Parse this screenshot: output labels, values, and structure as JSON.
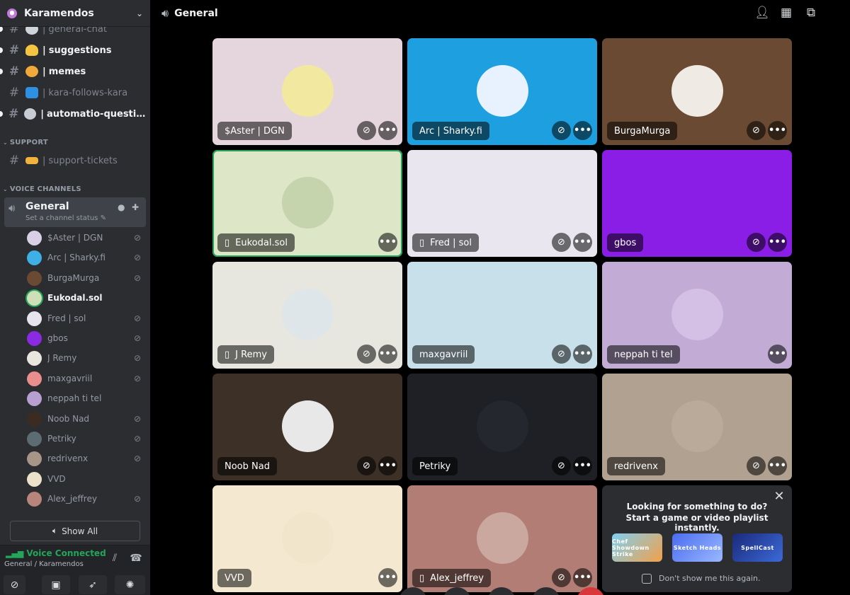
{
  "server": {
    "name": "Karamendos"
  },
  "channels": {
    "general_chat": "general-chat",
    "suggestions": "suggestions",
    "memes": "memes",
    "kara_follows": "kara-follows-kara",
    "automatio": "automatio-questio...",
    "separator": "|"
  },
  "categories": {
    "support": "SUPPORT",
    "voice": "VOICE CHANNELS"
  },
  "support_channels": {
    "tickets": "support-tickets"
  },
  "voice_channel": {
    "name": "General",
    "status_placeholder": "Set a channel status"
  },
  "voice_users": [
    {
      "name": "$Aster | DGN",
      "muted": true,
      "color": "#d9cfe6"
    },
    {
      "name": "Arc | Sharky.fi",
      "muted": true,
      "color": "#3fb0e6"
    },
    {
      "name": "BurgaMurga",
      "muted": true,
      "color": "#6b4a34"
    },
    {
      "name": "Eukodal.sol",
      "muted": false,
      "speaking": true,
      "color": "#cfe0b8"
    },
    {
      "name": "Fred | sol",
      "muted": true,
      "color": "#e8e4ee"
    },
    {
      "name": "gbos",
      "muted": true,
      "color": "#8a2be2"
    },
    {
      "name": "J Remy",
      "muted": true,
      "color": "#e8e6df"
    },
    {
      "name": "maxgavriil",
      "muted": true,
      "color": "#e98d8d"
    },
    {
      "name": "neppah ti tel",
      "muted": false,
      "color": "#b79fd1"
    },
    {
      "name": "Noob Nad",
      "muted": true,
      "color": "#3a2c22"
    },
    {
      "name": "Petriky",
      "muted": true,
      "color": "#5d6b73"
    },
    {
      "name": "redrivenx",
      "muted": true,
      "color": "#a79588"
    },
    {
      "name": "VVD",
      "muted": false,
      "color": "#ece2c9"
    },
    {
      "name": "Alex_jeffrey",
      "muted": true,
      "color": "#b7857c"
    }
  ],
  "show_all": "Show All",
  "voice_panel": {
    "status": "Voice Connected",
    "location": "General / Karamendos"
  },
  "topbar": {
    "channel": "General"
  },
  "tiles": [
    {
      "name": "$Aster | DGN",
      "bg": "#e4d6dc",
      "avatar": "#f2e8a0",
      "phone": false,
      "mute": true
    },
    {
      "name": "Arc | Sharky.fi",
      "bg": "#1ea0e0",
      "avatar": "#e8f2ff",
      "phone": false,
      "mute": true
    },
    {
      "name": "BurgaMurga",
      "bg": "#6b4a34",
      "avatar": "#efeae4",
      "phone": false,
      "mute": true
    },
    {
      "name": "Eukodal.sol",
      "bg": "#dde6c7",
      "avatar": "#c5d4ad",
      "phone": true,
      "mute": false
    },
    {
      "name": "Fred | sol",
      "bg": "#e9e6ef",
      "avatar": "#e9e6ef",
      "phone": true,
      "mute": true
    },
    {
      "name": "gbos",
      "bg": "#8a1ee6",
      "avatar": "#8a1ee6",
      "phone": false,
      "mute": true
    },
    {
      "name": "J Remy",
      "bg": "#e7e6df",
      "avatar": "#dfe6ea",
      "phone": true,
      "mute": true
    },
    {
      "name": "maxgavriil",
      "bg": "#c8e0ea",
      "avatar": "#c8e0ea",
      "phone": false,
      "mute": true
    },
    {
      "name": "neppah ti tel",
      "bg": "#c2acd6",
      "avatar": "#d3c0e4",
      "phone": false,
      "mute": false
    },
    {
      "name": "Noob Nad",
      "bg": "#3d3026",
      "avatar": "#e8e8e8",
      "phone": false,
      "mute": true
    },
    {
      "name": "Petriky",
      "bg": "#1e2025",
      "avatar": "#24282e",
      "phone": false,
      "mute": true
    },
    {
      "name": "redrivenx",
      "bg": "#b0a190",
      "avatar": "#b9aa9a",
      "phone": false,
      "mute": true
    },
    {
      "name": "VVD",
      "bg": "#f4e8d0",
      "avatar": "#f1e5cc",
      "phone": false,
      "mute": false
    },
    {
      "name": "Alex_jeffrey",
      "bg": "#b27d74",
      "avatar": "#caa79f",
      "phone": true,
      "mute": true
    }
  ],
  "activity": {
    "line1": "Looking for something to do?",
    "line2": "Start a game or video playlist instantly.",
    "games": [
      "Chef Showdown Strike",
      "Sketch Heads",
      "SpellCast"
    ],
    "dont_show": "Don't show me this again."
  }
}
